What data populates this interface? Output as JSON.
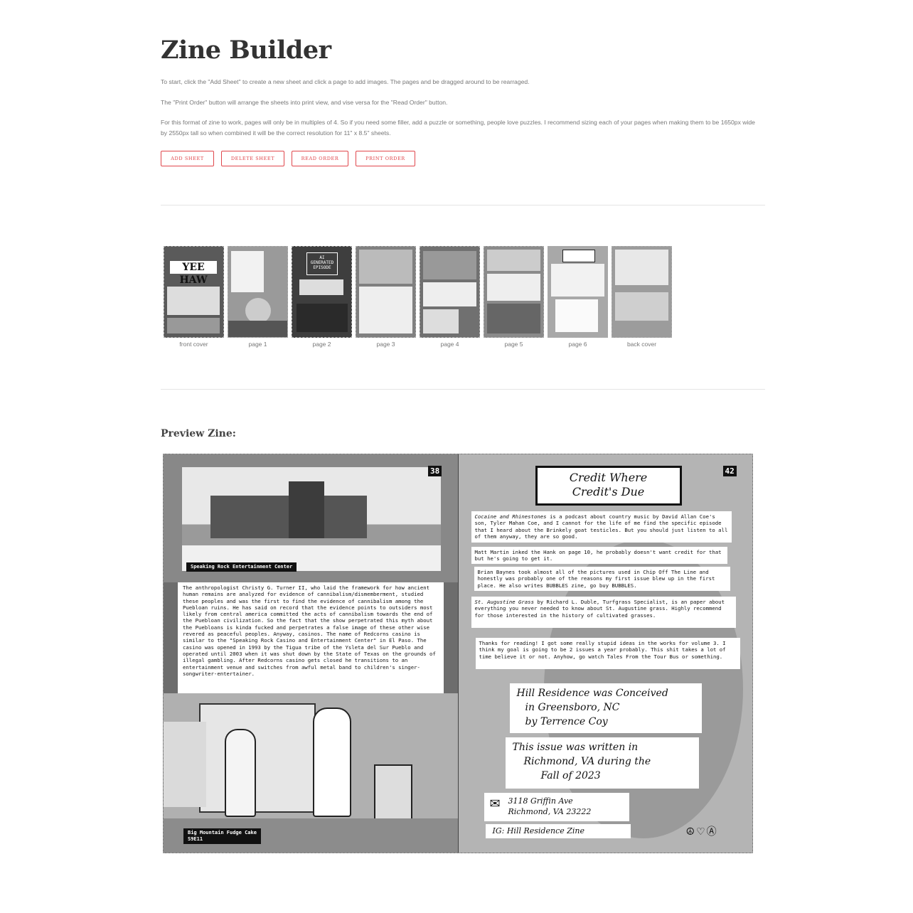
{
  "header": {
    "title": "Zine Builder",
    "para1": "To start, click the \"Add Sheet\" to create a new sheet and click a page to add images. The pages and be dragged around to be rearraged.",
    "para2": "The \"Print Order\" button will arrange the sheets into print view, and vise versa for the \"Read Order\" button.",
    "para3": "For this format of zine to work, pages will only be in multiples of 4. So if you need some filler, add a puzzle or something, people love puzzles. I recommend sizing each of your pages when making them to be 1650px wide by 2550px tall so when combined it will be the correct resolution for 11\" x 8.5\" sheets."
  },
  "toolbar": {
    "add_sheet": "Add Sheet",
    "delete_sheet": "Delete Sheet",
    "read_order": "Read Order",
    "print_order": "Print Order"
  },
  "thumbnails": [
    {
      "label": "front cover",
      "art": "YEE HAW"
    },
    {
      "label": "page 1",
      "art": ""
    },
    {
      "label": "page 2",
      "art": "AI GENERATED EPISODE"
    },
    {
      "label": "page 3",
      "art": ""
    },
    {
      "label": "page 4",
      "art": ""
    },
    {
      "label": "page 5",
      "art": ""
    },
    {
      "label": "page 6",
      "art": ""
    },
    {
      "label": "back cover",
      "art": ""
    }
  ],
  "preview": {
    "heading": "Preview Zine:",
    "left": {
      "page_number": "38",
      "photo_caption": "Speaking Rock Entertainment Center",
      "body": "The anthropologist Christy G. Turner II, who laid the framework for how ancient human remains are analyzed for evidence of cannibalism/dismemberment, studied these peoples and was the first to find the evidence of cannibalism among the Puebloan ruins. He has said on record that the evidence points to outsiders most likely from central america committed the acts of cannibalism towards the end of the Puebloan civilization. So the fact that the show perpetrated this myth about the Puebloans is kinda fucked and perpetrates a false image of these other wise revered as peaceful peoples. Anyway, casinos. The name of Redcorns casino is similar to the \"Speaking Rock Casino and Entertainment Center\" in El Paso. The casino was opened in 1993 by the Tigua tribe of the Ysleta del Sur Pueblo and operated until 2003 when it was shut down by the State of Texas on the grounds of illegal gambling. After Redcorns casino gets closed he transitions to an entertainment venue and switches from awful metal band to children's singer-songwriter-entertainer.",
      "episode_caption": "Big Mountain Fudge Cake",
      "episode_code": "S9E11"
    },
    "right": {
      "page_number": "42",
      "heading_line1": "Credit Where",
      "heading_line2": "Credit's Due",
      "credit1_title": "Cocaine and Rhinestones",
      "credit1": " is a podcast about country music by David Allan Coe's son, Tyler Mahan Coe, and I cannot for the life of me find the specific episode that I heard about the Brinkely goat testicles. But you should just listen to all of them anyway, they are so good.",
      "credit2": "Matt Martin inked the Hank on page 10, he probably doesn't want credit for that but he's going to get it.",
      "credit3": "Brian Baynes took almost all of the pictures used in Chip Off The Line and honestly was probably one of the reasons my first issue blew up in the first place. He also writes BUBBLES zine, go buy BUBBLES.",
      "credit4_title": "St. Augustine Grass",
      "credit4": " by Richard L. Duble, Turfgrass Specialist, is an paper about everything you never needed to know about St. Augustine grass. Highly recommend for those interested in the history of cultivated grasses.",
      "credit5": "Thanks for reading! I got some really stupid ideas in the works for volume 3. I think my goal is going to be 2 issues a year probably. This shit takes a lot of time believe it or not. Anyhow, go watch Tales From the Tour Bus or something.",
      "hand1_line1": "Hill Residence was Conceived",
      "hand1_line2": "in Greensboro, NC",
      "hand1_line3": "by Terrence Coy",
      "hand2_line1": "This issue was written in",
      "hand2_line2": "Richmond, VA during the",
      "hand2_line3": "Fall of 2023",
      "address_line1": "3118 Griffin Ave",
      "address_line2": "Richmond, VA 23222",
      "ig": "IG: Hill Residence Zine"
    }
  }
}
